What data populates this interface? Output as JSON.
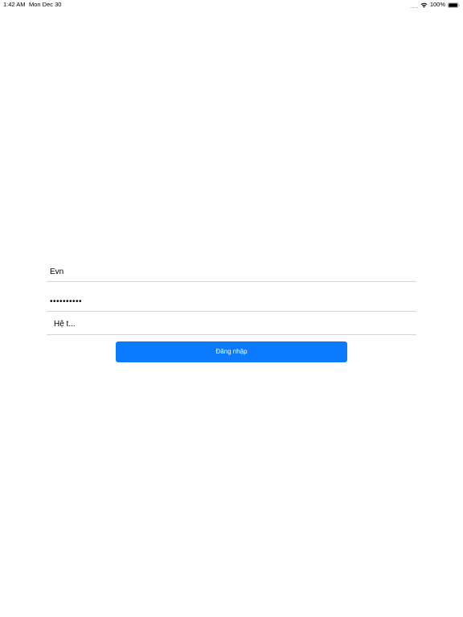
{
  "status_bar": {
    "time": "1:42 AM",
    "date": "Mon Dec 30",
    "battery_percent": "100%",
    "icons": [
      "signal-dots-icon",
      "wifi-icon",
      "battery-icon"
    ]
  },
  "login_form": {
    "username_value": "Evn",
    "password_masked": "••••••••••",
    "system_value": "Hệ t...",
    "login_button_label": "Đăng nhập"
  },
  "colors": {
    "accent": "#0a7bff",
    "divider": "#d6d6d6",
    "background": "#ffffff"
  }
}
